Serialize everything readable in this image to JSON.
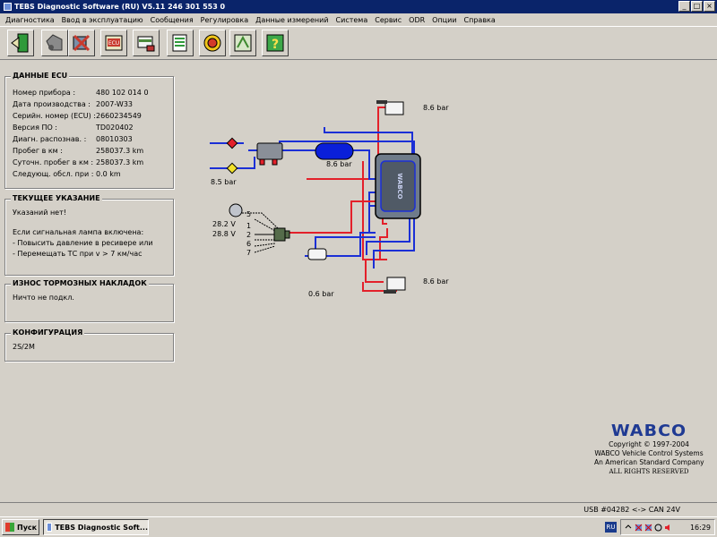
{
  "window": {
    "title": "TEBS Diagnostic Software (RU) V5.11  246 301 553 0",
    "btn_min": "_",
    "btn_max": "□",
    "btn_close": "×"
  },
  "menu": [
    "Диагностика",
    "Ввод в эксплуатацию",
    "Сообщения",
    "Регулировка",
    "Данные измерений",
    "Система",
    "Сервис",
    "ODR",
    "Опции",
    "Справка"
  ],
  "toolbar": {
    "buttons": [
      {
        "icon": "exit-door-icon",
        "color": "#2f9a3a"
      },
      {
        "icon": "trailer-connect-icon",
        "color": "#7a7a7a"
      },
      {
        "icon": "diagnosis-icon",
        "color": "#c83b2e"
      },
      {
        "icon": "ecu-icon",
        "color": "#c83b2e"
      },
      {
        "icon": "measure-icon",
        "color": "#4d8a3c"
      },
      {
        "icon": "document-icon",
        "color": "#2f9a3a"
      },
      {
        "icon": "brake-icon",
        "color": "#d23a2a"
      },
      {
        "icon": "settings-icon",
        "color": "#3e8a2f"
      },
      {
        "icon": "help-icon",
        "color": "#2e8a3a"
      }
    ]
  },
  "ecu_panel": {
    "title": "ДАННЫЕ ECU",
    "rows": [
      {
        "label": "Номер прибора :",
        "value": "480 102 014 0"
      },
      {
        "label": "Дата производства :",
        "value": "2007-W33"
      },
      {
        "label": "Серийн. номер (ECU) :",
        "value": "2660234549"
      },
      {
        "label": "Версия ПО :",
        "value": "TD020402"
      },
      {
        "label": "Диагн. распознав. :",
        "value": "08010303"
      },
      {
        "label": "Пробег в км :",
        "value": "258037.3 km"
      },
      {
        "label": "Суточн. пробег в км :",
        "value": "258037.3 km"
      },
      {
        "label": "Следующ. обсл. при :",
        "value": "0.0 km"
      }
    ]
  },
  "hint_panel": {
    "title": "ТЕКУЩЕЕ УКАЗАНИЕ",
    "lines": [
      "Указаний нет!",
      "",
      "Если сигнальная лампа включена:",
      "- Повысить давление в ресивере или",
      "- Перемещать ТС при v > 7 км/час"
    ]
  },
  "pads_panel": {
    "title": "ИЗНОС ТОРМОЗНЫХ НАКЛАДОК",
    "text": "Ничто не подкл."
  },
  "config_panel": {
    "title": "КОНФИГУРАЦИЯ",
    "text": "2S/2M"
  },
  "diagram": {
    "pressure_top_right": "8.6 bar",
    "pressure_reservoir": "8.6 bar",
    "pressure_supply": "8.5 bar",
    "pressure_bottom_right": "8.6 bar",
    "pressure_bottom_small": "0.6 bar",
    "voltage_1": "28.2 V",
    "voltage_2": "28.8 V",
    "pins": [
      "5",
      "1",
      "2",
      "6",
      "7"
    ],
    "colors": {
      "red": "#e3202a",
      "blue": "#1b2fd6",
      "tank": "#0a1fd9",
      "ecu": "#6f7b8a"
    }
  },
  "brand": {
    "logo": "WABCO",
    "lines": [
      "Copyright © 1997-2004",
      "WABCO Vehicle Control Systems",
      "An American Standard Company"
    ],
    "rights": "ALL RIGHTS RESERVED"
  },
  "status": "USB #04282 <-> CAN 24V",
  "taskbar": {
    "start": "Пуск",
    "task": "TEBS Diagnostic Soft...",
    "lang": "RU",
    "clock": "16:29"
  }
}
